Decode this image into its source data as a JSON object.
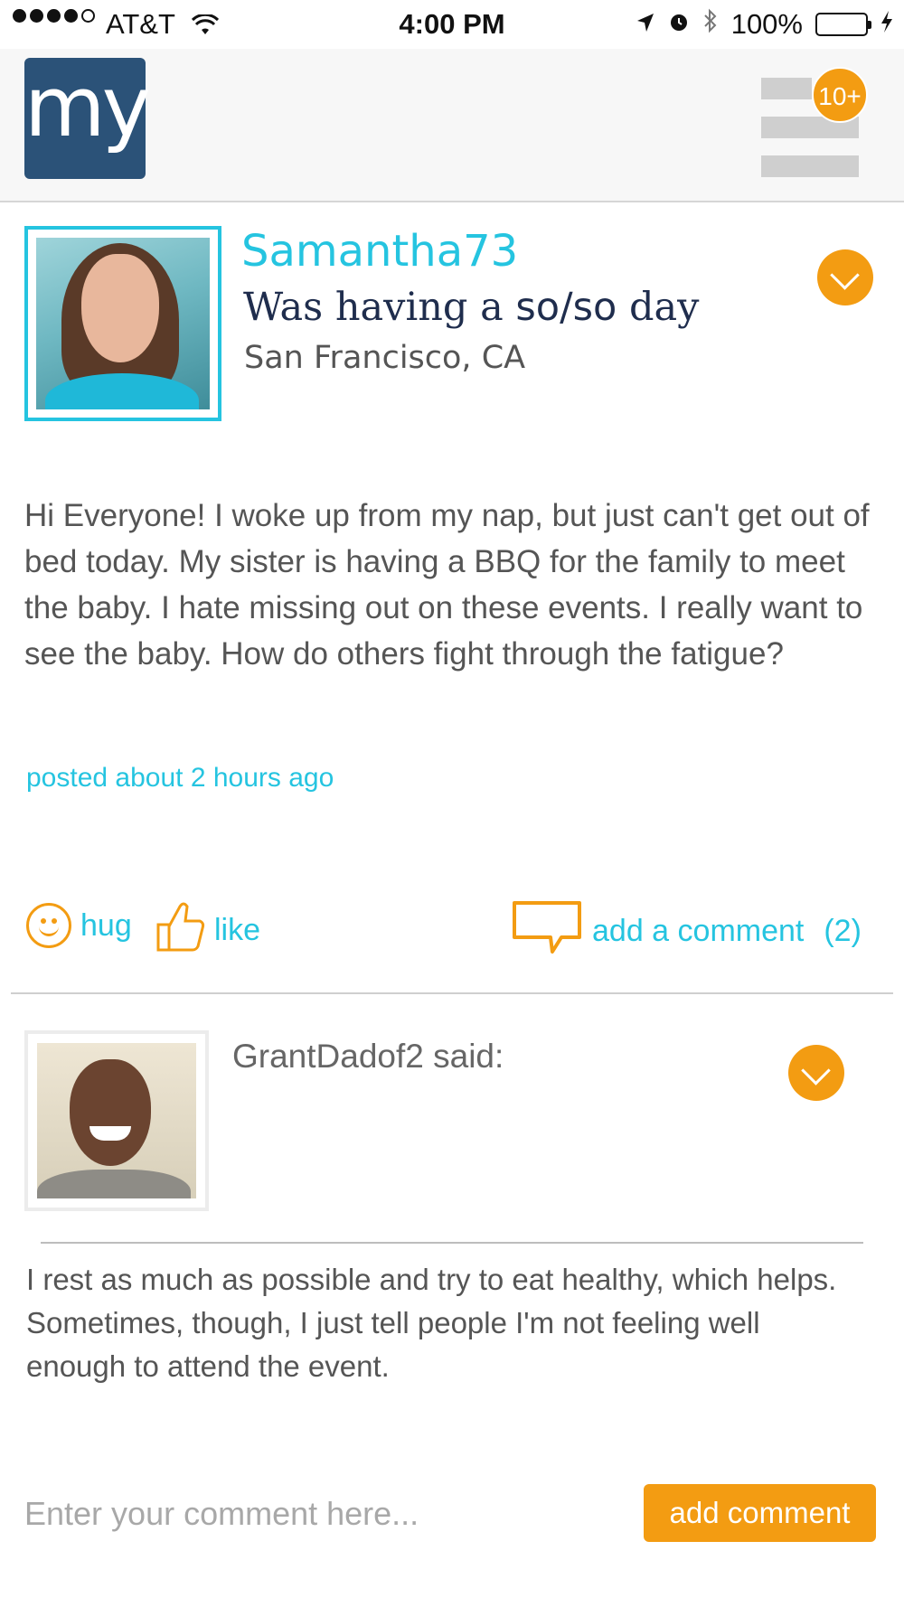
{
  "status_bar": {
    "carrier": "AT&T",
    "time": "4:00 PM",
    "battery": "100%"
  },
  "header": {
    "logo_text": "my",
    "notification_badge": "10+"
  },
  "post": {
    "username": "Samantha73",
    "mood_prefix": "Was having a ",
    "mood_value": "so/so",
    "mood_suffix": " day",
    "location": "San Francisco, CA",
    "body": "Hi Everyone! I woke up from my nap, but just can't get out of bed today. My sister is having a BBQ for the family to meet the baby. I hate missing out on these events. I really want to see the baby. How do others fight through the fatigue?",
    "posted": "posted about 2 hours ago",
    "actions": {
      "hug": "hug",
      "like": "like",
      "add_comment": "add a comment",
      "comment_count": "(2)"
    }
  },
  "comment": {
    "author": "GrantDadof2 said:",
    "body": "I rest as much as possible and try to eat healthy, which helps. Sometimes, though, I just tell people I'm not feeling well enough to attend the event."
  },
  "comment_form": {
    "placeholder": "Enter your comment here...",
    "submit_label": "add comment"
  },
  "colors": {
    "accent": "#25c4e0",
    "orange": "#f39c12",
    "brand_navy": "#2b5278"
  }
}
